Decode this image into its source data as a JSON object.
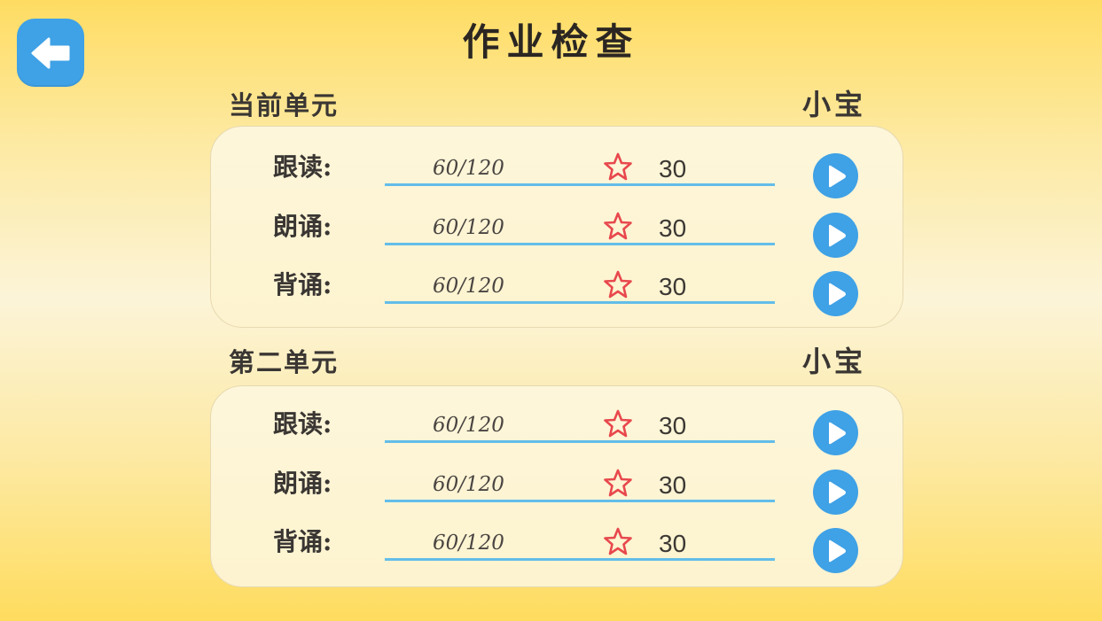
{
  "header": {
    "back_icon": "arrow-left-icon",
    "title": "作业检查"
  },
  "colors": {
    "accent_blue": "#3fa1e6",
    "underline_blue": "#63bde9",
    "star_red": "#e8484d",
    "background_yellow": "#fedc62"
  },
  "sections": [
    {
      "title": "当前单元",
      "student": "小宝",
      "rows": [
        {
          "label": "跟读:",
          "progress": "60/120",
          "score": "30"
        },
        {
          "label": "朗诵:",
          "progress": "60/120",
          "score": "30"
        },
        {
          "label": "背诵:",
          "progress": "60/120",
          "score": "30"
        }
      ]
    },
    {
      "title": "第二单元",
      "student": "小宝",
      "rows": [
        {
          "label": "跟读:",
          "progress": "60/120",
          "score": "30"
        },
        {
          "label": "朗诵:",
          "progress": "60/120",
          "score": "30"
        },
        {
          "label": "背诵:",
          "progress": "60/120",
          "score": "30"
        }
      ]
    }
  ]
}
